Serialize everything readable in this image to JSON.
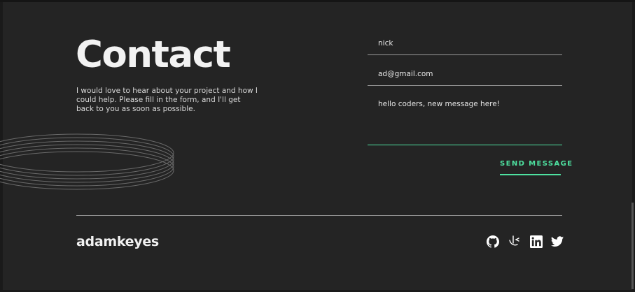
{
  "contact": {
    "title": "Contact",
    "intro": "I would love to hear about your project and how I could help. Please fill in the form, and I'll get back to you as soon as possible."
  },
  "form": {
    "name_value": "nick",
    "email_value": "ad@gmail.com",
    "message_value": "hello coders, new message here!",
    "send_label": "SEND MESSAGE"
  },
  "footer": {
    "brand": "adamkeyes",
    "social_icons": [
      "github-icon",
      "frontend-mentor-icon",
      "linkedin-icon",
      "twitter-icon"
    ]
  },
  "colors": {
    "background": "#242424",
    "accent": "#4ee1a0",
    "text": "#f2f2f2"
  }
}
